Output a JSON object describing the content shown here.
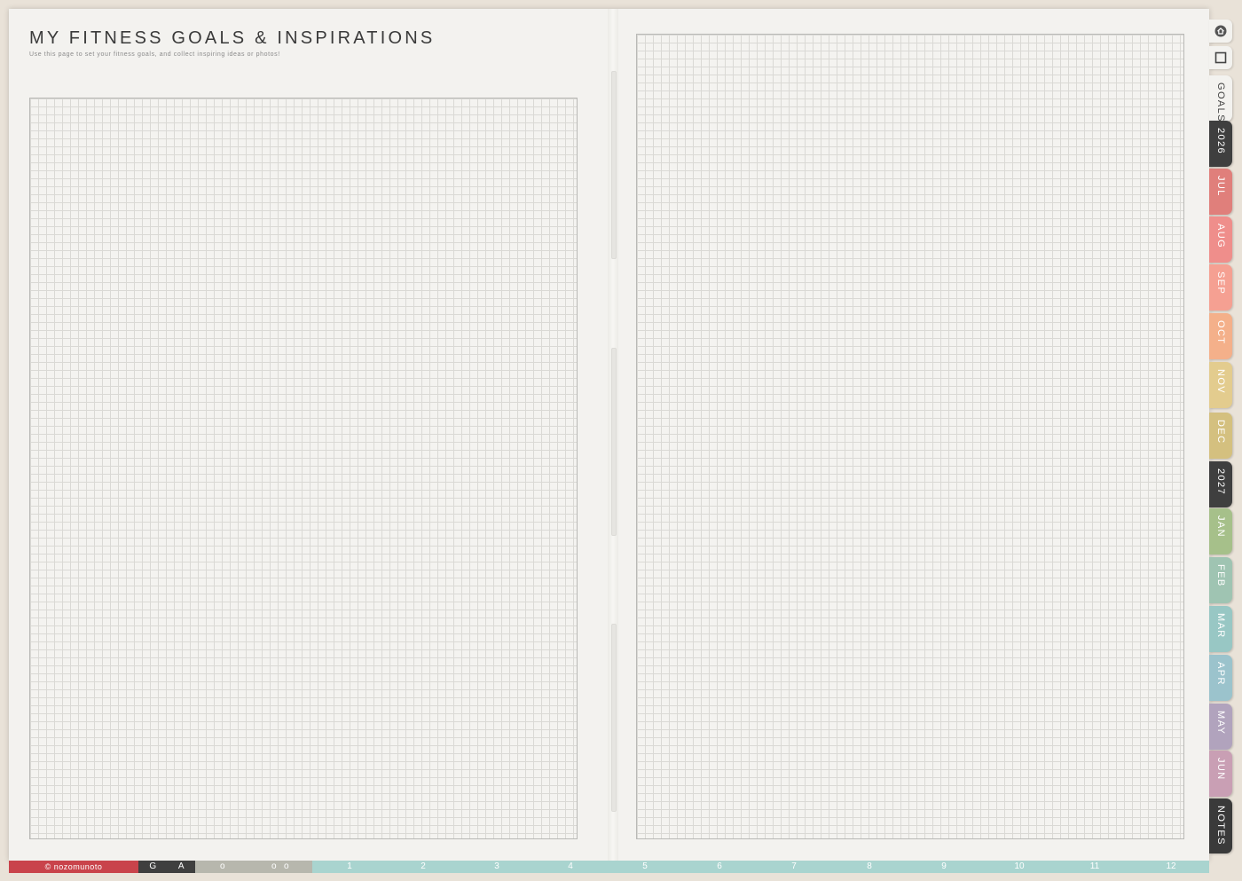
{
  "page": {
    "title": "MY FITNESS GOALS & INSPIRATIONS",
    "subtitle": "Use this page to set your fitness goals, and collect inspiring ideas or photos!"
  },
  "side_icons": [
    {
      "name": "home-icon"
    },
    {
      "name": "square-icon"
    }
  ],
  "side_tabs": [
    {
      "label": "GOALS",
      "color": "#f3f2ef",
      "text_color": "#444444"
    },
    {
      "label": "2026",
      "color": "#3f3f3f",
      "text_color": "#ffffff"
    },
    {
      "label": "JUL",
      "color": "#e07f7b",
      "text_color": "#ffffff"
    },
    {
      "label": "AUG",
      "color": "#ef8e8b",
      "text_color": "#ffffff"
    },
    {
      "label": "SEP",
      "color": "#f5a092",
      "text_color": "#ffffff"
    },
    {
      "label": "OCT",
      "color": "#f4b08a",
      "text_color": "#ffffff"
    },
    {
      "label": "NOV",
      "color": "#e3cc8e",
      "text_color": "#ffffff"
    },
    {
      "label": "DEC",
      "color": "#d4c07f",
      "text_color": "#ffffff"
    },
    {
      "label": "2027",
      "color": "#3f3f3f",
      "text_color": "#ffffff"
    },
    {
      "label": "JAN",
      "color": "#a6c08a",
      "text_color": "#ffffff"
    },
    {
      "label": "FEB",
      "color": "#9fc4b2",
      "text_color": "#ffffff"
    },
    {
      "label": "MAR",
      "color": "#98c7c4",
      "text_color": "#ffffff"
    },
    {
      "label": "APR",
      "color": "#9bc3cc",
      "text_color": "#ffffff"
    },
    {
      "label": "MAY",
      "color": "#b1a3bd",
      "text_color": "#ffffff"
    },
    {
      "label": "JUN",
      "color": "#c99fb4",
      "text_color": "#ffffff"
    },
    {
      "label": "NOTES",
      "color": "#3a3a3a",
      "text_color": "#ffffff"
    }
  ],
  "bottom_bar": {
    "brand": "© nozomunoto",
    "dark_tabs": [
      "G",
      "A"
    ],
    "gray_tabs": [
      "o",
      "o",
      "o"
    ],
    "month_numbers": [
      "1",
      "2",
      "3",
      "4",
      "5",
      "6",
      "7",
      "8",
      "9",
      "10",
      "11",
      "12"
    ]
  }
}
